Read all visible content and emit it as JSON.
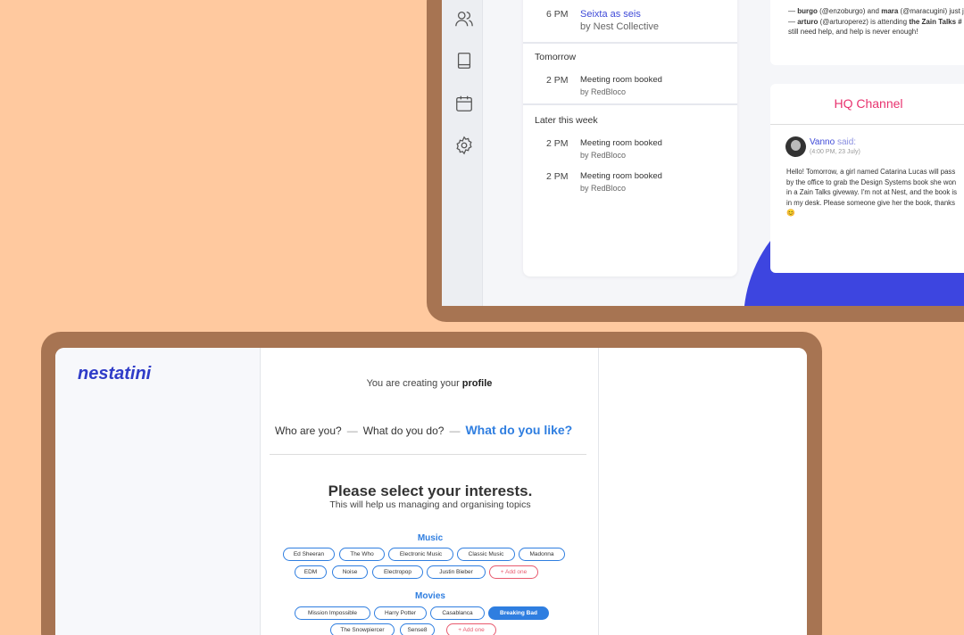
{
  "colors": {
    "background": "#ffc99f",
    "device_frame": "#a77452",
    "brand_blue": "#2f3cc8",
    "accent_blue": "#2f7ee0",
    "hq_pink": "#e8336f",
    "add_red": "#e85a6e"
  },
  "sidebar": {
    "icons": [
      "users-icon",
      "book-icon",
      "calendar-icon",
      "settings-icon"
    ]
  },
  "events": {
    "first": {
      "time": "6 PM",
      "title": "Seixta as seis",
      "by": "by Nest Collective"
    },
    "tomorrow": {
      "heading": "Tomorrow",
      "items": [
        {
          "time": "2 PM",
          "title": "Meeting room booked",
          "by": "by RedBloco"
        }
      ]
    },
    "later": {
      "heading": "Later this week",
      "items": [
        {
          "time": "2 PM",
          "title": "Meeting room booked",
          "by": "by RedBloco"
        },
        {
          "time": "2 PM",
          "title": "Meeting room booked",
          "by": "by RedBloco"
        }
      ]
    }
  },
  "activity": {
    "line1_user1": "burgo",
    "line1_handle1": "(@enzoburgo) and ",
    "line1_user2": "mara",
    "line1_handle2": " (@maracugini) just j",
    "line2_user": "arturo",
    "line2_rest": " (@arturoperez) is attending ",
    "line2_event": "the Zain Talks #",
    "line3": "still need help, and help is never enough!"
  },
  "hq": {
    "title": "HQ Channel",
    "author": "Vanno",
    "said": " said:",
    "date": "(4:00 PM, 23 July)",
    "message": "Hello! Tomorrow, a girl named Catarina Lucas will pass by the office to grab the Design Systems book she won in a Zain Talks giveway. I'm not at Nest, and the book is in my desk. Please someone give her the book, thanks 😊"
  },
  "profile": {
    "logo": "nestatini",
    "creating_prefix": "You are creating your ",
    "creating_bold": "profile",
    "steps": [
      "Who are you?",
      "What do you do?",
      "What do you like?"
    ],
    "step_separator": "—",
    "heading": "Please select your interests.",
    "subheading": "This will help us managing and organising topics",
    "categories": [
      {
        "name": "Music",
        "chips": [
          "Ed Sheeran",
          "The Who",
          "Electronic Music",
          "Classic Music",
          "Madonna",
          "EDM",
          "Noise",
          "Electropop",
          "Justin Bieber",
          "+ Add one"
        ]
      },
      {
        "name": "Movies",
        "chips": [
          "Mission Impossible",
          "Harry Potter",
          "Casablanca",
          "Breaking Bad",
          "The Snowpiercer",
          "Sense8",
          "+ Add one"
        ]
      }
    ]
  }
}
